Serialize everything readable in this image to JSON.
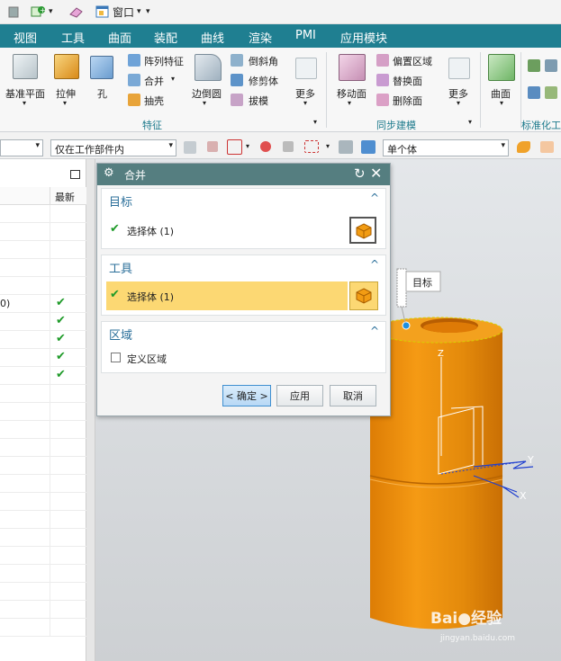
{
  "quick_access": {
    "window_label": "窗口",
    "arrow": "▾"
  },
  "menu": [
    "视图",
    "工具",
    "曲面",
    "装配",
    "曲线",
    "渲染",
    "PMI",
    "应用模块"
  ],
  "ribbon": {
    "datum_plane": "基准平面",
    "extrude": "拉伸",
    "hole": "孔",
    "pattern_feature": "阵列特征",
    "unite": "合并",
    "shell": "抽壳",
    "edge_blend": "边倒圆",
    "chamfer": "倒斜角",
    "trim_body": "修剪体",
    "draft": "拔模",
    "more_1": "更多",
    "features_group": "特征",
    "move_face": "移动面",
    "offset_region": "偏置区域",
    "replace_face": "替换面",
    "delete_face": "删除面",
    "more_2": "更多",
    "sync_group": "同步建模",
    "surface": "曲面",
    "std_group": "标准化工"
  },
  "selection_bar": {
    "filter_scope": "仅在工作部件内",
    "body_filter": "单个体"
  },
  "navigator": {
    "column_latest": "最新",
    "partial_text": "0)",
    "checks": 5
  },
  "dialog": {
    "title": "合并",
    "target_section": "目标",
    "target_select": "选择体 (1)",
    "tool_section": "工具",
    "tool_select": "选择体 (1)",
    "region_section": "区域",
    "define_region": "定义区域",
    "ok": "< 确定 >",
    "apply": "应用",
    "cancel": "取消"
  },
  "viewport": {
    "target_tag": "目标",
    "axis_z": "Z",
    "axis_y": "Y",
    "axis_x": "X"
  },
  "watermark": {
    "site": "jingyan.baidu.com"
  },
  "colors": {
    "menubar": "#1f7f91",
    "title": "#557e80",
    "accent": "#f5a01f",
    "highlight": "#fcd873",
    "check": "#1e9a28"
  }
}
